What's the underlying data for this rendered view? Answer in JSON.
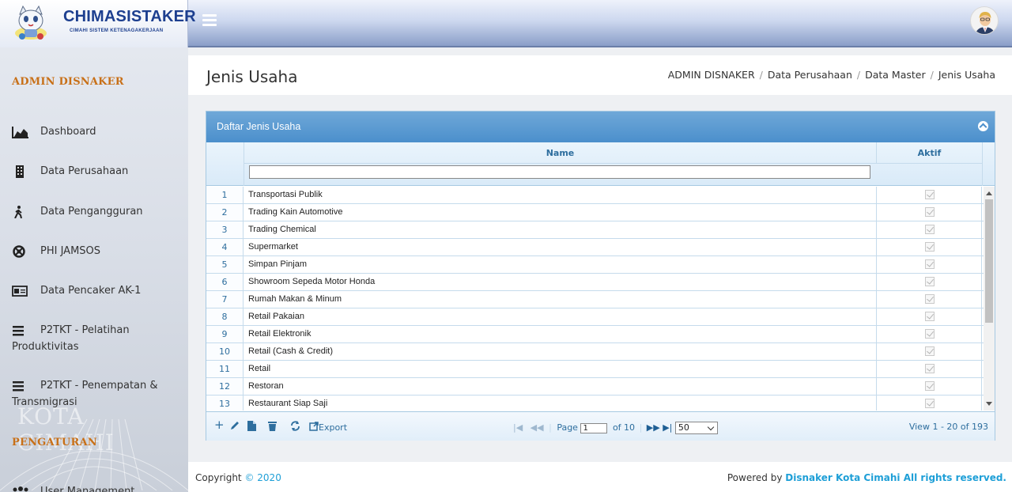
{
  "app": {
    "title": "CHIMASISTAKER",
    "subtitle": "CIMAHI SISTEM KETENAGAKERJAAN"
  },
  "sidebar": {
    "heading": "ADMIN DISNAKER",
    "items": [
      {
        "label": "Dashboard",
        "icon": "area-chart-icon"
      },
      {
        "label": "Data Perusahaan",
        "icon": "building-icon"
      },
      {
        "label": "Data Pengangguran",
        "icon": "walking-person-icon"
      },
      {
        "label": "PHI JAMSOS",
        "icon": "life-ring-icon"
      },
      {
        "label": "Data Pencaker AK-1",
        "icon": "id-card-icon"
      },
      {
        "label": "P2TKT - Pelatihan Produktivitas",
        "icon": "bars-icon"
      },
      {
        "label": "P2TKT - Penempatan & Transmigrasi",
        "icon": "bars-icon"
      }
    ],
    "section2_heading": "PENGATURAN",
    "items2": [
      {
        "label": "User Management",
        "icon": "users-icon"
      }
    ],
    "watermark": "KOTA CIMAHI"
  },
  "page": {
    "title": "Jenis Usaha",
    "breadcrumb": [
      "ADMIN DISNAKER",
      "Data Perusahaan",
      "Data Master",
      "Jenis Usaha"
    ]
  },
  "panel": {
    "title": "Daftar Jenis Usaha",
    "columns": {
      "name": "Name",
      "active": "Aktif"
    },
    "filter_value": "",
    "rows": [
      {
        "no": "1",
        "name": "Transportasi Publik",
        "active": true
      },
      {
        "no": "2",
        "name": "Trading Kain Automotive",
        "active": true
      },
      {
        "no": "3",
        "name": "Trading Chemical",
        "active": true
      },
      {
        "no": "4",
        "name": "Supermarket",
        "active": true
      },
      {
        "no": "5",
        "name": "Simpan Pinjam",
        "active": true
      },
      {
        "no": "6",
        "name": "Showroom Sepeda Motor Honda",
        "active": true
      },
      {
        "no": "7",
        "name": "Rumah Makan & Minum",
        "active": true
      },
      {
        "no": "8",
        "name": "Retail Pakaian",
        "active": true
      },
      {
        "no": "9",
        "name": "Retail Elektronik",
        "active": true
      },
      {
        "no": "10",
        "name": "Retail (Cash & Credit)",
        "active": true
      },
      {
        "no": "11",
        "name": "Retail",
        "active": true
      },
      {
        "no": "12",
        "name": "Restoran",
        "active": true
      },
      {
        "no": "13",
        "name": "Restaurant Siap Saji",
        "active": true
      }
    ],
    "pager": {
      "export_label": "Export",
      "page_label": "Page",
      "page_value": "1",
      "of_label": "of 10",
      "rows_per_page": "50",
      "view_text": "View 1 - 20 of 193"
    }
  },
  "footer": {
    "copyright_prefix": "Copyright",
    "year": "© 2020",
    "powered_prefix": "Powered by",
    "powered_brand": "Disnaker Kota Cimahi All rights reserved."
  },
  "colors": {
    "accent": "#4b8fcc",
    "link": "#1e9fd7",
    "sidebar_heading": "#c87018",
    "grid_text": "#2e6e9e"
  }
}
